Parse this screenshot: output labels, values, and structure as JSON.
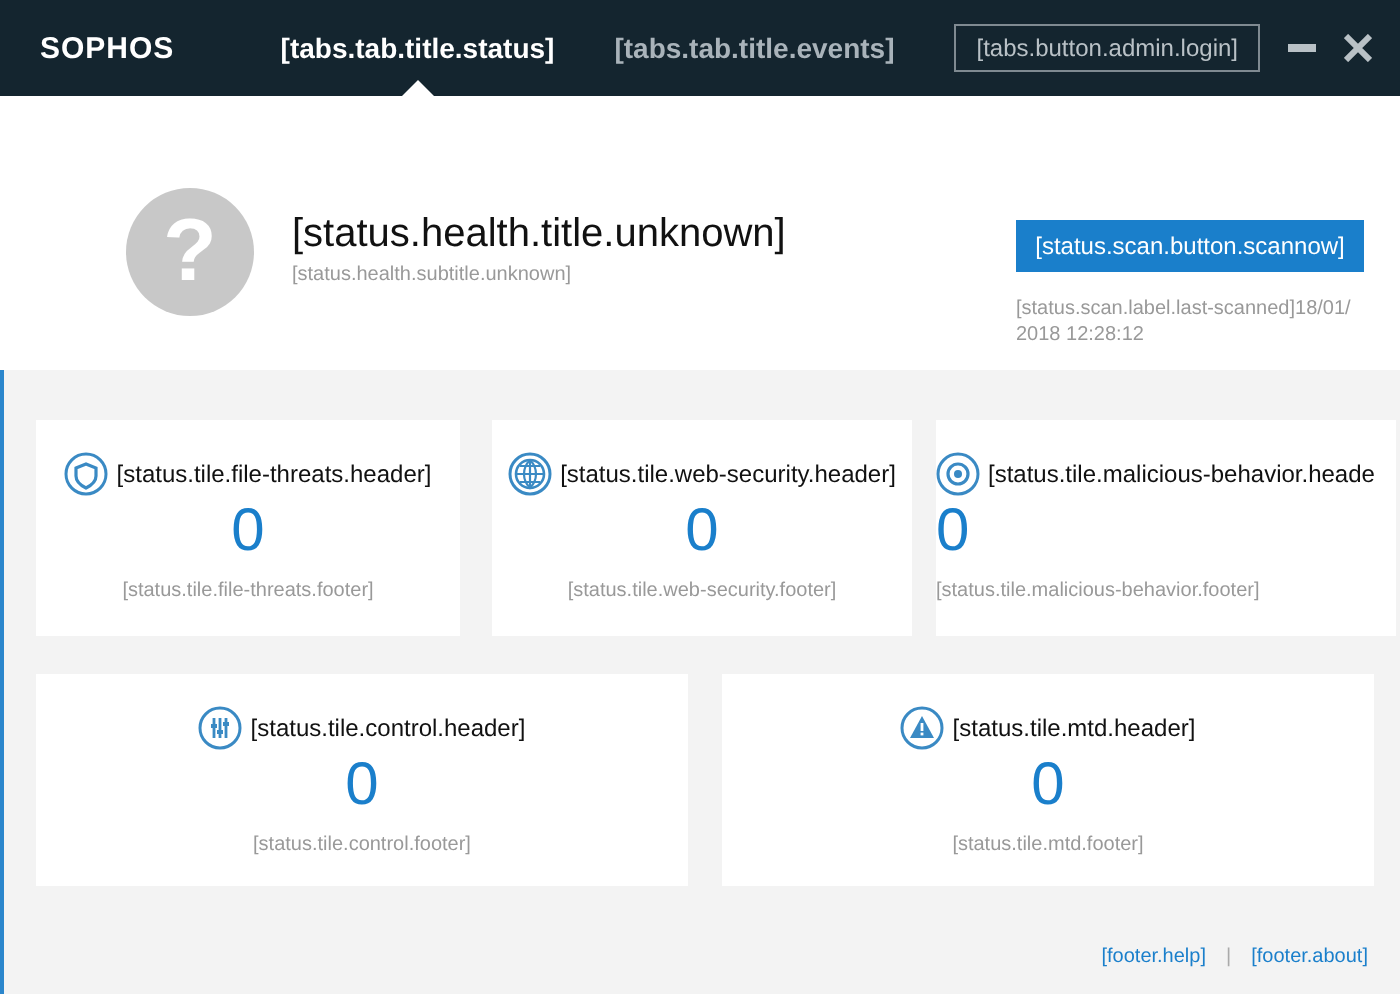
{
  "header": {
    "logo": "SOPHOS",
    "tabs": [
      {
        "label": "[tabs.tab.title.status]",
        "selected": true
      },
      {
        "label": "[tabs.tab.title.events]",
        "selected": false
      }
    ],
    "login_button": "[tabs.button.admin.login]"
  },
  "health": {
    "icon": "?",
    "title": "[status.health.title.unknown]",
    "subtitle": "[status.health.subtitle.unknown]"
  },
  "scan": {
    "button": "[status.scan.button.scannow]",
    "last_scanned": "[status.scan.label.last-scanned]18/01/2018 12:28:12"
  },
  "tiles": [
    {
      "kind": "shield",
      "header": "[status.tile.file-threats.header]",
      "count": "0",
      "footer": "[status.tile.file-threats.footer]"
    },
    {
      "kind": "globe",
      "header": "[status.tile.web-security.header]",
      "count": "0",
      "footer": "[status.tile.web-security.footer]"
    },
    {
      "kind": "target",
      "header": "[status.tile.malicious-behavior.heade",
      "count": "0",
      "footer": "[status.tile.malicious-behavior.footer]"
    },
    {
      "kind": "sliders",
      "header": "[status.tile.control.header]",
      "count": "0",
      "footer": "[status.tile.control.footer]"
    },
    {
      "kind": "warning",
      "header": "[status.tile.mtd.header]",
      "count": "0",
      "footer": "[status.tile.mtd.footer]"
    }
  ],
  "footer": {
    "links": [
      "[footer.help]",
      "[footer.about]"
    ],
    "separator": "|"
  }
}
